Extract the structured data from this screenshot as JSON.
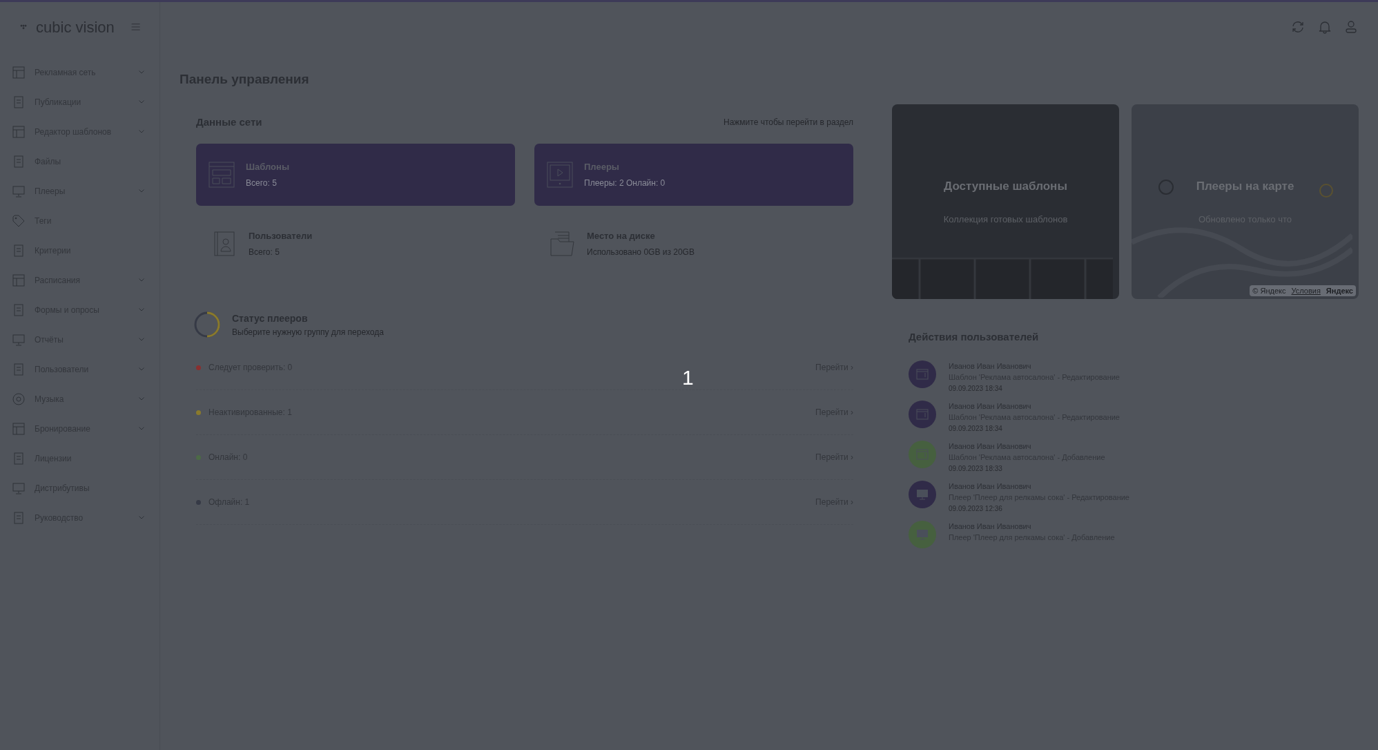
{
  "brand": "cubic vision",
  "sidebar": {
    "items": [
      {
        "label": "Рекламная сеть",
        "expandable": true
      },
      {
        "label": "Публикации",
        "expandable": true
      },
      {
        "label": "Редактор шаблонов",
        "expandable": true
      },
      {
        "label": "Файлы",
        "expandable": false
      },
      {
        "label": "Плееры",
        "expandable": true
      },
      {
        "label": "Теги",
        "expandable": false
      },
      {
        "label": "Критерии",
        "expandable": false
      },
      {
        "label": "Расписания",
        "expandable": true
      },
      {
        "label": "Формы и опросы",
        "expandable": true
      },
      {
        "label": "Отчёты",
        "expandable": true
      },
      {
        "label": "Пользователи",
        "expandable": true
      },
      {
        "label": "Музыка",
        "expandable": true
      },
      {
        "label": "Бронирование",
        "expandable": true
      },
      {
        "label": "Лицензии",
        "expandable": false
      },
      {
        "label": "Дистрибутивы",
        "expandable": false
      },
      {
        "label": "Руководство",
        "expandable": true
      }
    ]
  },
  "page_title": "Панель управления",
  "network": {
    "title": "Данные сети",
    "hint": "Нажмите чтобы перейти в раздел",
    "tiles": [
      {
        "title": "Шаблоны",
        "subtitle": "Всего: 5",
        "highlighted": true
      },
      {
        "title": "Плееры",
        "subtitle": "Плееры: 2 Онлайн: 0",
        "highlighted": true
      },
      {
        "title": "Пользователи",
        "subtitle": "Всего: 5",
        "highlighted": false
      },
      {
        "title": "Место на диске",
        "subtitle": "Использовано 0GB из 20GB",
        "highlighted": false
      }
    ]
  },
  "player_status": {
    "title": "Статус плееров",
    "subtitle": "Выберите нужную группу для перехода",
    "rows": [
      {
        "label": "Следует проверить: 0",
        "color": "#8a2f2f",
        "link": "Перейти ›"
      },
      {
        "label": "Неактивированные: 1",
        "color": "#8a7a2c",
        "link": "Перейти ›"
      },
      {
        "label": "Онлайн: 0",
        "color": "#4c6a46",
        "link": "Перейти ›"
      },
      {
        "label": "Офлайн: 1",
        "color": "#363a46",
        "link": "Перейти ›"
      }
    ]
  },
  "promo_cards": [
    {
      "kind": "photo",
      "title": "Доступные шаблоны",
      "subtitle": "Коллекция готовых шаблонов"
    },
    {
      "kind": "map",
      "title": "Плееры на карте",
      "subtitle": "Обновлено только что",
      "copyright": "© Яндекс",
      "terms": "Условия",
      "logo": "Яндекс"
    }
  ],
  "user_actions": {
    "title": "Действия пользователей",
    "items": [
      {
        "user": "Иванов Иван Иванович",
        "action": "Шаблон 'Реклама автосалона' - Редактирование",
        "time": "09.09.2023 18:34",
        "color": "#302b48",
        "kind": "template"
      },
      {
        "user": "Иванов Иван Иванович",
        "action": "Шаблон 'Реклама автосалона' - Редактирование",
        "time": "09.09.2023 18:34",
        "color": "#302b48",
        "kind": "template"
      },
      {
        "user": "Иванов Иван Иванович",
        "action": "Шаблон 'Реклама автосалона' - Добавление",
        "time": "09.09.2023 18:33",
        "color": "#46603f",
        "kind": "template"
      },
      {
        "user": "Иванов Иван Иванович",
        "action": "Плеер 'Плеер для релкамы сока' - Редактирование",
        "time": "09.09.2023 12:36",
        "color": "#302b48",
        "kind": "player"
      },
      {
        "user": "Иванов Иван Иванович",
        "action": "Плеер 'Плеер для релкамы сока' - Добавление",
        "color": "#46603f",
        "kind": "player"
      }
    ]
  },
  "overlay_marker": "1"
}
